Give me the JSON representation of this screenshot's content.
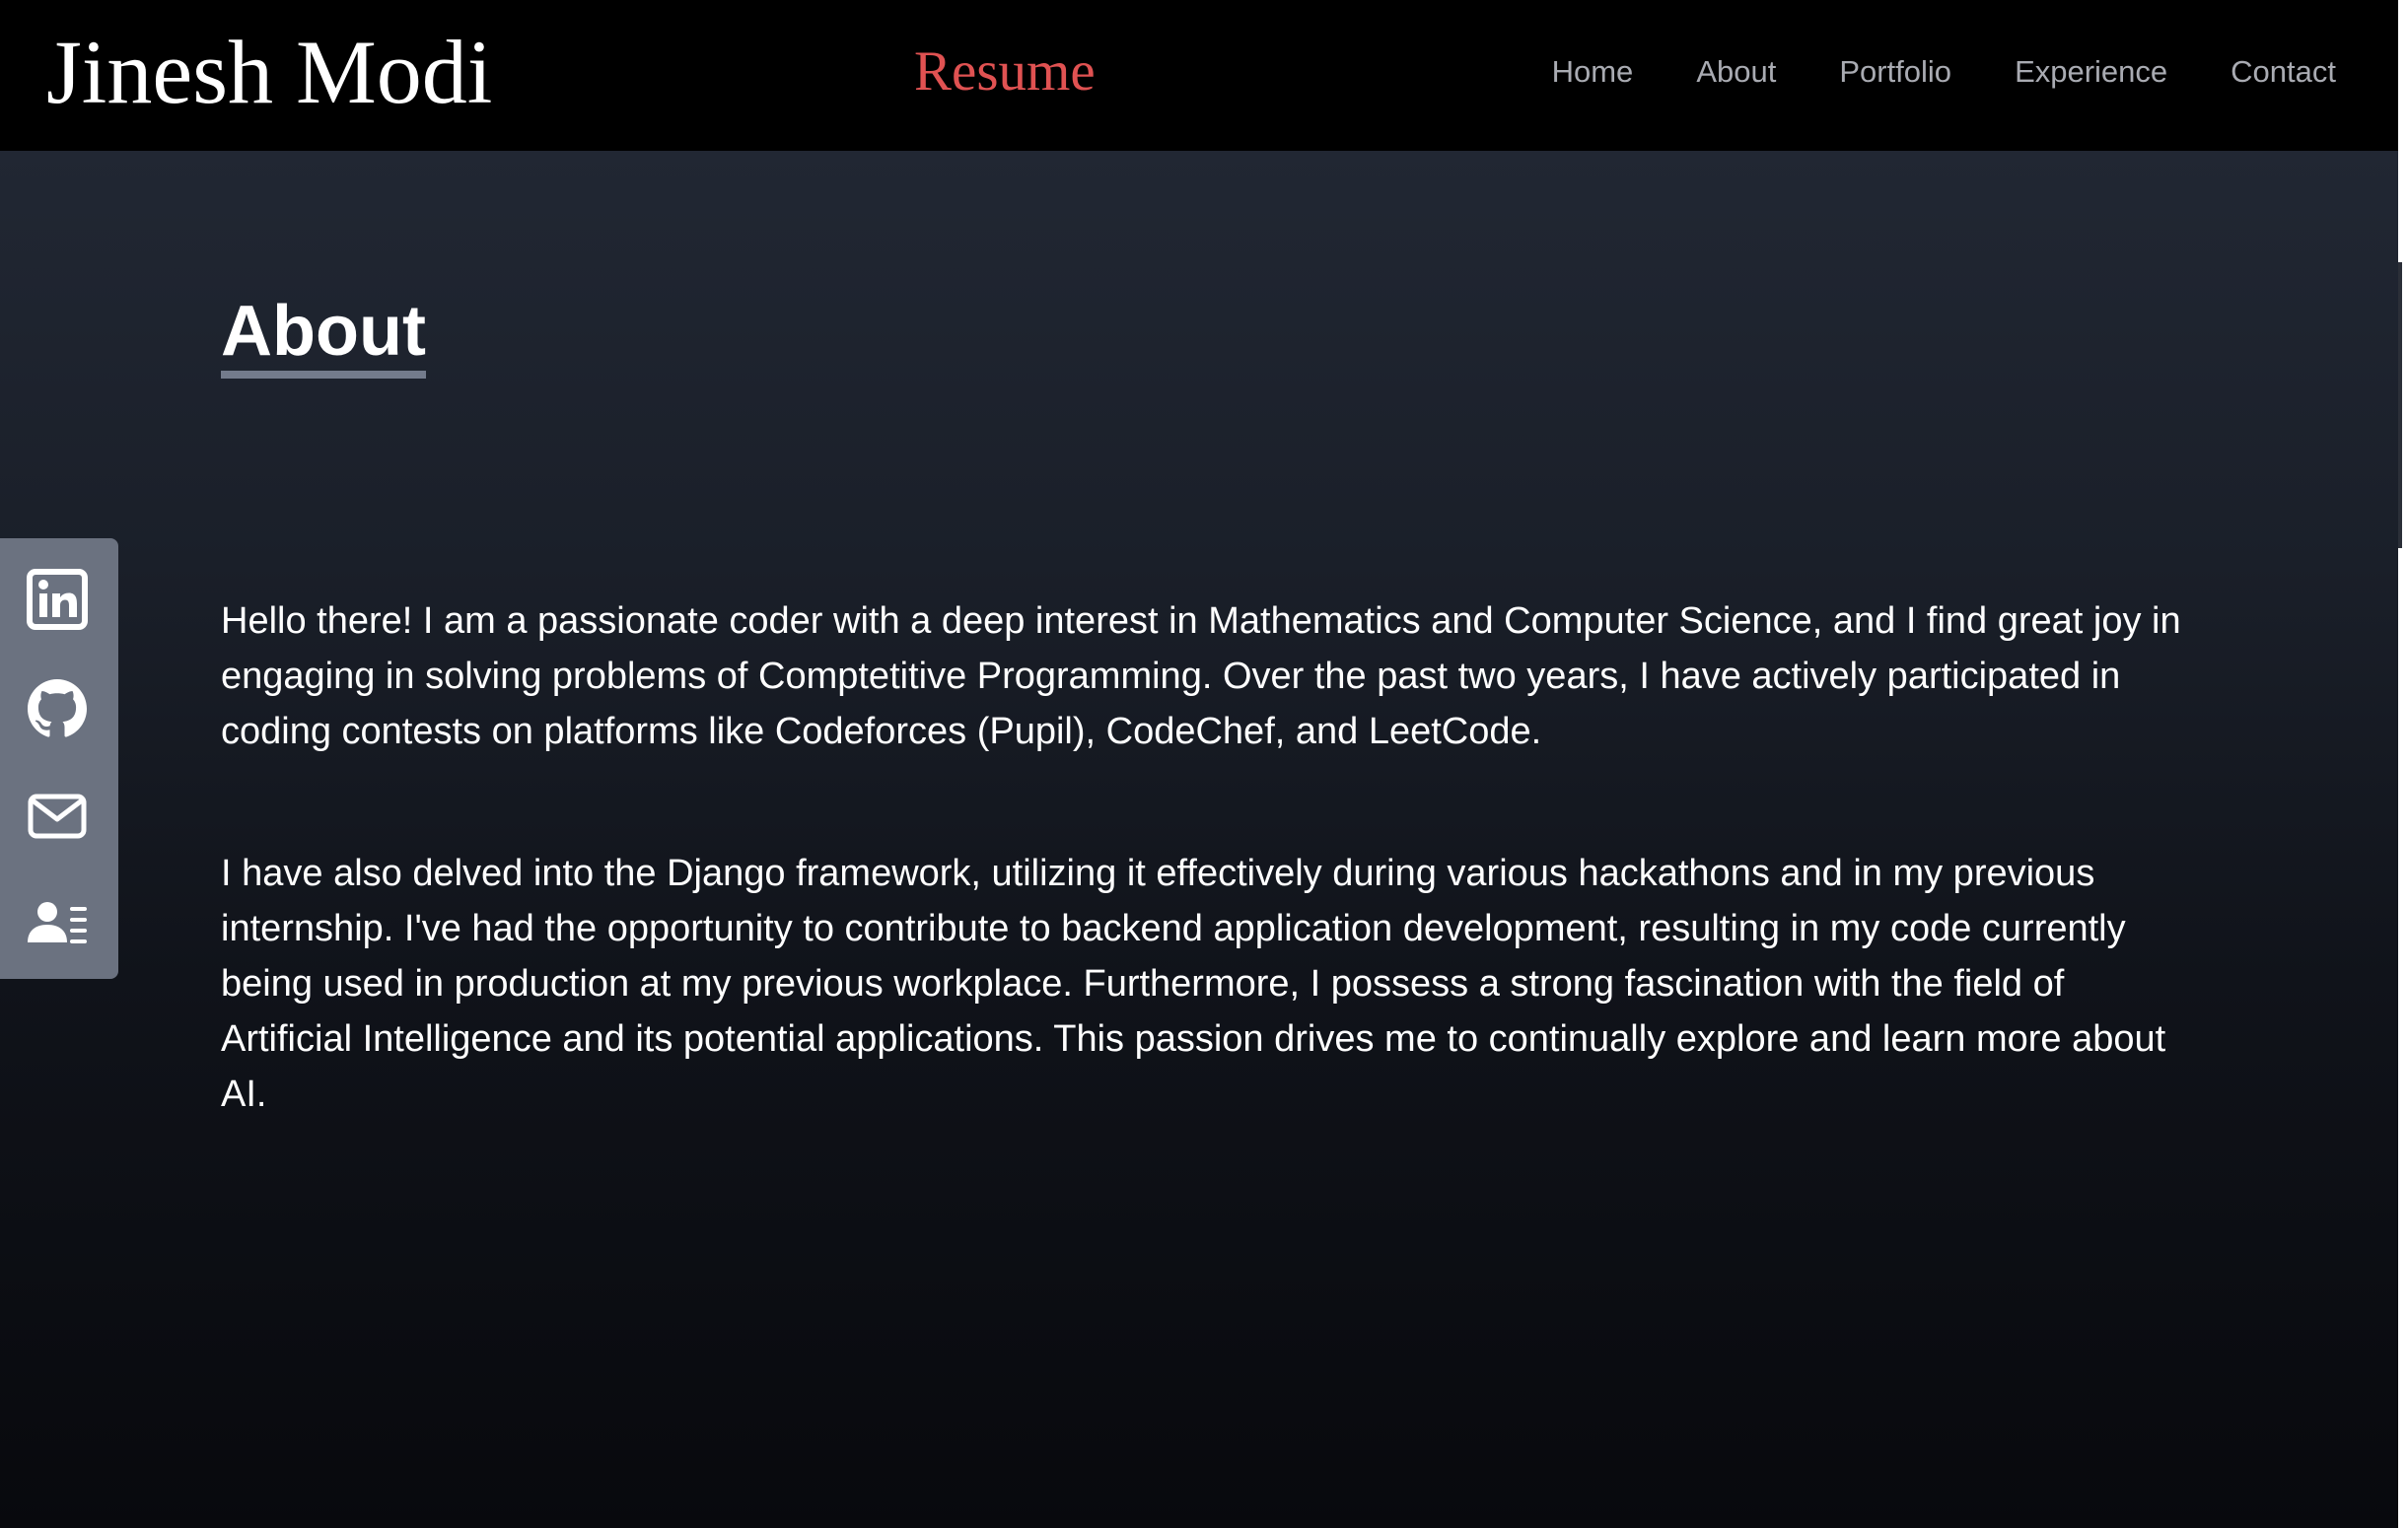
{
  "header": {
    "brand": "Jinesh Modi",
    "resume_link": "Resume",
    "nav": [
      {
        "label": "Home"
      },
      {
        "label": "About"
      },
      {
        "label": "Portfolio"
      },
      {
        "label": "Experience"
      },
      {
        "label": "Contact"
      }
    ]
  },
  "about": {
    "title": "About",
    "paragraphs": [
      "Hello there! I am a passionate coder with a deep interest in Mathematics and Computer Science, and I find great joy in engaging in solving problems of Comptetitive Programming. Over the past two years, I have actively participated in coding contests on platforms like Codeforces (Pupil), CodeChef, and LeetCode.",
      "I have also delved into the Django framework, utilizing it effectively during various hackathons and in my previous internship. I've had the opportunity to contribute to backend application development, resulting in my code currently being used in production at my previous workplace. Furthermore, I possess a strong fascination with the field of Artificial Intelligence and its potential applications. This passion drives me to continually explore and learn more about AI."
    ]
  },
  "social": [
    {
      "icon": "linkedin-icon"
    },
    {
      "icon": "github-icon"
    },
    {
      "icon": "email-icon"
    },
    {
      "icon": "resume-icon"
    }
  ],
  "colors": {
    "accent": "#e05252",
    "nav_text": "#a9abb2",
    "sidebar_bg": "#6b7280",
    "underline": "#737b8c"
  }
}
